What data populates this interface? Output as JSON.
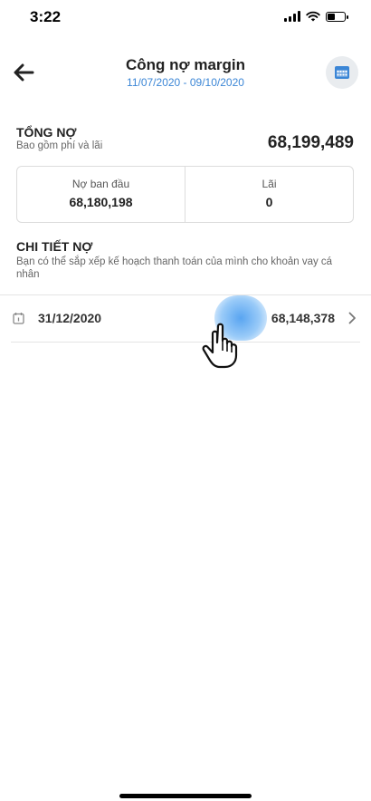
{
  "status_bar": {
    "time": "3:22"
  },
  "header": {
    "title": "Công nợ margin",
    "date_range": "11/07/2020 - 09/10/2020"
  },
  "total_debt": {
    "label": "TỔNG NỢ",
    "sublabel": "Bao gồm phí và lãi",
    "value": "68,199,489"
  },
  "breakdown": {
    "principal_label": "Nợ ban đầu",
    "principal_value": "68,180,198",
    "interest_label": "Lãi",
    "interest_value": "0"
  },
  "debt_detail": {
    "label": "CHI TIẾT NỢ",
    "sublabel": "Bạn có thể sắp xếp kế hoạch thanh toán của mình cho khoản vay cá nhân"
  },
  "debt_rows": [
    {
      "date": "31/12/2020",
      "amount": "68,148,378"
    }
  ],
  "colors": {
    "accent": "#3b86d6",
    "calendar_button_bg": "#e9ecef"
  },
  "icons": {
    "back": "arrow-left-icon",
    "calendar": "calendar-icon",
    "row": "calendar-clock-icon",
    "chevron": "chevron-right-icon",
    "touch": "hand-pointer-icon"
  }
}
